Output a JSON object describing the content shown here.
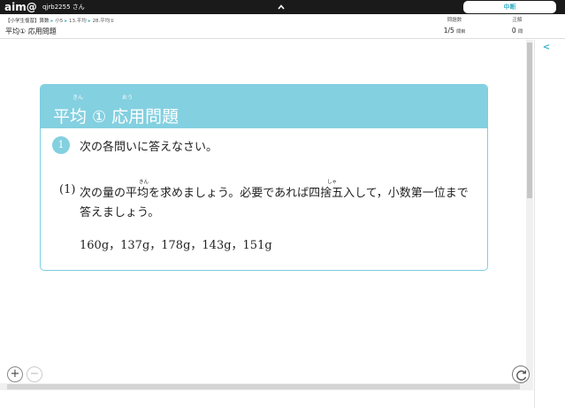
{
  "topbar": {
    "logo": "aim@",
    "user": "qjrb2255 さん",
    "stop_label": "中断"
  },
  "header": {
    "breadcrumb": [
      "【小学生復習】算数",
      "小5",
      "13.平均",
      "28.平均①"
    ],
    "page_title": "平均① 応用問題",
    "question_count_label": "問題数",
    "question_count_value": "1/5",
    "question_count_unit": "問目",
    "correct_label": "正解",
    "correct_value": "0",
    "correct_unit": "問"
  },
  "card": {
    "title_part1": "平均",
    "title_circle": "①",
    "title_part2": "応用問題",
    "ruby1": "きん",
    "ruby2": "おう",
    "question_number": "1",
    "question_text": "次の各問いに答えなさい。",
    "sub_label": "(1)",
    "sub_line1": "次の量の平均を求めましょう。必要であれば四捨五入して，小数第一位まで",
    "sub_line2": "答えましょう。",
    "furigana_kin": "きん",
    "furigana_sha": "しゃ",
    "values": "160g，137g，178g，143g，151g"
  },
  "controls": {
    "zoom_in": "+",
    "zoom_out": "−",
    "panel_toggle": "<"
  }
}
